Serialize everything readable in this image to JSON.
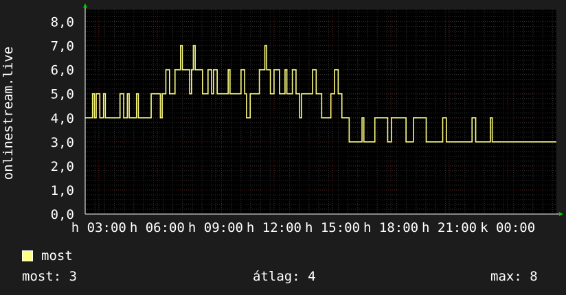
{
  "colors": {
    "background": "#1c1c1c",
    "plot_background": "#000000",
    "grid_major": "#5a2020",
    "grid_minor": "#2f2f2f",
    "series": "#ffff80",
    "axis_arrow": "#00cc00",
    "text": "#ffffff"
  },
  "chart_data": {
    "type": "line",
    "ylabel": "onlinestream.live",
    "ylim": [
      0,
      8.5
    ],
    "y_ticks": [
      "0,0",
      "1,0",
      "2,0",
      "3,0",
      "4,0",
      "5,0",
      "6,0",
      "7,0",
      "8,0"
    ],
    "y_tick_values": [
      0,
      1,
      2,
      3,
      4,
      5,
      6,
      7,
      8
    ],
    "x_ticks": [
      "h 03:00",
      "h 06:00",
      "h 09:00",
      "h 12:00",
      "h 15:00",
      "h 18:00",
      "h 21:00",
      "k 00:00"
    ],
    "x_range_hours": [
      0,
      24.2
    ],
    "x_tick_hours": [
      0.7,
      3.7,
      6.7,
      9.7,
      12.7,
      15.7,
      18.7,
      21.7
    ],
    "grid": true,
    "series": [
      {
        "name": "most",
        "values": [
          4,
          4,
          4,
          4,
          5,
          4,
          5,
          5,
          4,
          4,
          5,
          4,
          4,
          4,
          4,
          4,
          4,
          4,
          4,
          5,
          5,
          4,
          4,
          5,
          4,
          4,
          4,
          4,
          5,
          4,
          4,
          4,
          4,
          4,
          4,
          4,
          5,
          5,
          5,
          5,
          5,
          4,
          5,
          5,
          6,
          6,
          5,
          5,
          5,
          6,
          6,
          6,
          7,
          6,
          6,
          6,
          6,
          5,
          6,
          7,
          6,
          6,
          6,
          6,
          5,
          5,
          5,
          6,
          6,
          5,
          6,
          6,
          5,
          5,
          5,
          5,
          5,
          5,
          6,
          5,
          5,
          5,
          5,
          5,
          5,
          6,
          6,
          5,
          4,
          4,
          5,
          5,
          5,
          5,
          5,
          6,
          6,
          6,
          7,
          6,
          6,
          5,
          5,
          6,
          6,
          6,
          5,
          5,
          5,
          6,
          5,
          5,
          5,
          6,
          6,
          5,
          5,
          4,
          5,
          5,
          5,
          5,
          5,
          5,
          6,
          6,
          5,
          5,
          5,
          4,
          4,
          4,
          4,
          4,
          5,
          5,
          6,
          6,
          5,
          5,
          4,
          4,
          4,
          4,
          3,
          3,
          3,
          3,
          3,
          3,
          3,
          4,
          3,
          3,
          3,
          3,
          3,
          3,
          4,
          4,
          4,
          4,
          4,
          4,
          4,
          3,
          3,
          4,
          4,
          4,
          4,
          4,
          4,
          4,
          4,
          3,
          3,
          3,
          3,
          4,
          4,
          4,
          4,
          4,
          4,
          4,
          3,
          3,
          3,
          3,
          3,
          3,
          3,
          3,
          3,
          4,
          4,
          3,
          3,
          3,
          3,
          3,
          3,
          3,
          3,
          3,
          3,
          3,
          3,
          3,
          3,
          4,
          4,
          3,
          3,
          3,
          3,
          3,
          3,
          3,
          3,
          4,
          3,
          3,
          3,
          3,
          3,
          3,
          3,
          3,
          3,
          3,
          3,
          3,
          3,
          3,
          3,
          3,
          3,
          3,
          3,
          3,
          3,
          3,
          3,
          3,
          3,
          3,
          3,
          3,
          3,
          3,
          3,
          3,
          3,
          3,
          3
        ]
      }
    ]
  },
  "legend": {
    "label": "most"
  },
  "stats": {
    "current": "most: 3",
    "average": "átlag: 4",
    "max": "max: 8"
  }
}
